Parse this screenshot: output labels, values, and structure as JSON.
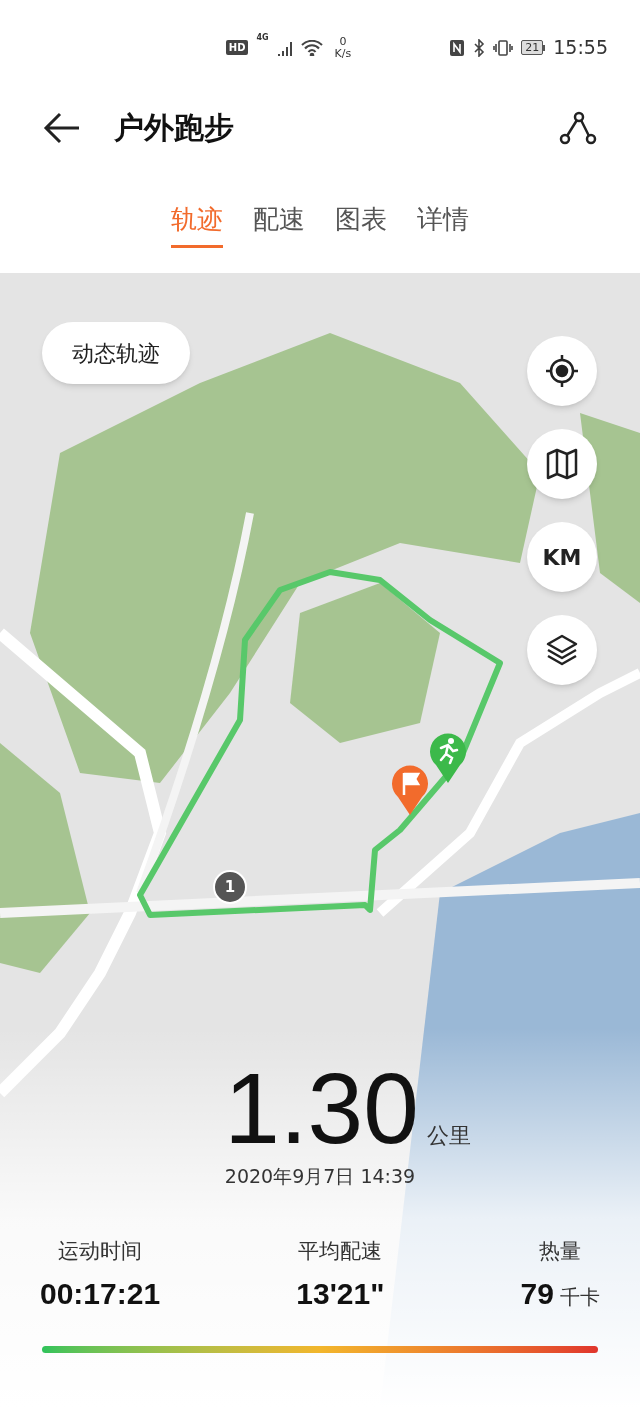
{
  "status_bar": {
    "hd_badge": "HD",
    "network_type": "4G",
    "speed_value": "0",
    "speed_unit": "K/s",
    "battery": "21",
    "time": "15:55"
  },
  "header": {
    "title": "户外跑步"
  },
  "tabs": [
    {
      "label": "轨迹",
      "selected": true
    },
    {
      "label": "配速",
      "selected": false
    },
    {
      "label": "图表",
      "selected": false
    },
    {
      "label": "详情",
      "selected": false
    }
  ],
  "map": {
    "mode_button": "动态轨迹",
    "controls": [
      {
        "kind": "locate"
      },
      {
        "kind": "map"
      },
      {
        "kind": "unit",
        "label": "KM"
      },
      {
        "kind": "layers"
      }
    ],
    "markers": [
      {
        "kind": "km",
        "label": "1"
      },
      {
        "kind": "finish"
      },
      {
        "kind": "runner"
      }
    ]
  },
  "summary": {
    "distance": "1.30",
    "distance_unit": "公里",
    "date": "2020年9月7日 14:39",
    "stats": [
      {
        "label": "运动时间",
        "value": "00:17:21"
      },
      {
        "label": "平均配速",
        "value": "13'21\""
      },
      {
        "label": "热量",
        "value": "79",
        "unit": "千卡"
      }
    ]
  }
}
